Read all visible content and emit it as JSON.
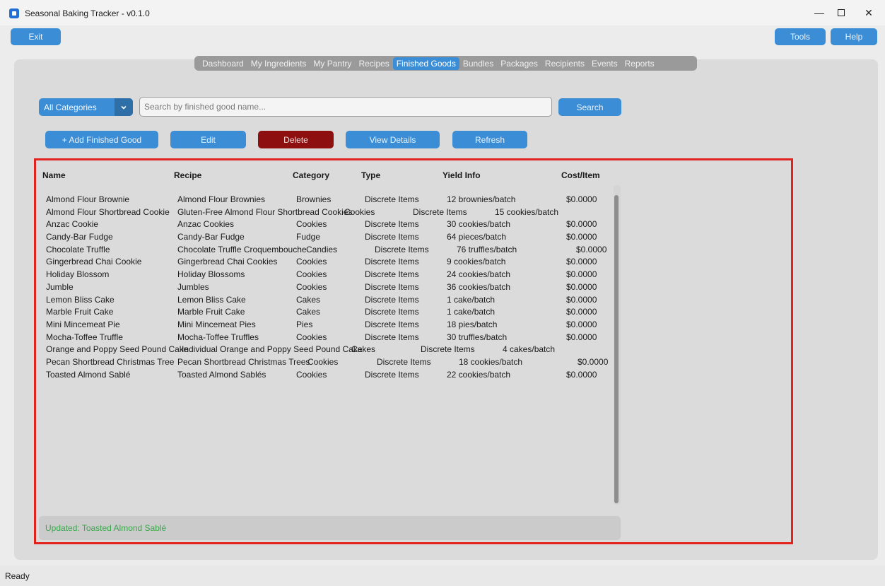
{
  "window": {
    "title": "Seasonal Baking Tracker - v0.1.0",
    "minimize_glyph": "—",
    "close_glyph": "✕"
  },
  "toolbar": {
    "exit_label": "Exit",
    "tools_label": "Tools",
    "help_label": "Help"
  },
  "tabs": [
    {
      "label": "Dashboard"
    },
    {
      "label": "My Ingredients"
    },
    {
      "label": "My Pantry"
    },
    {
      "label": "Recipes"
    },
    {
      "label": "Finished Goods",
      "active": true
    },
    {
      "label": "Bundles"
    },
    {
      "label": "Packages"
    },
    {
      "label": "Recipients"
    },
    {
      "label": "Events"
    },
    {
      "label": "Reports"
    }
  ],
  "filter": {
    "category_selected": "All Categories",
    "search_placeholder": "Search by finished good name...",
    "search_label": "Search"
  },
  "actions": {
    "add_label": "+ Add Finished Good",
    "edit_label": "Edit",
    "delete_label": "Delete",
    "view_label": "View Details",
    "refresh_label": "Refresh"
  },
  "table": {
    "headers": {
      "name": "Name",
      "recipe": "Recipe",
      "category": "Category",
      "type": "Type",
      "yield": "Yield Info",
      "cost": "Cost/Item"
    },
    "rows": [
      {
        "name": "Almond Flour Brownie",
        "recipe": "Almond Flour Brownies",
        "category": "Brownies",
        "type": "Discrete Items",
        "yield": "12 brownies/batch",
        "cost": "$0.0000"
      },
      {
        "name": "Almond Flour Shortbread Cookie",
        "recipe": "Gluten-Free Almond Flour Shortbread Cookies",
        "category": "Cookies",
        "type": "Discrete Items",
        "yield": "15 cookies/batch",
        "cost": ""
      },
      {
        "name": "Anzac Cookie",
        "recipe": "Anzac Cookies",
        "category": "Cookies",
        "type": "Discrete Items",
        "yield": "30 cookies/batch",
        "cost": "$0.0000"
      },
      {
        "name": "Candy-Bar Fudge",
        "recipe": "Candy-Bar Fudge",
        "category": "Fudge",
        "type": "Discrete Items",
        "yield": "64 pieces/batch",
        "cost": "$0.0000"
      },
      {
        "name": "Chocolate Truffle",
        "recipe": "Chocolate Truffle Croquembouche",
        "category": "Candies",
        "type": "Discrete Items",
        "yield": "76 truffles/batch",
        "cost": "$0.0000"
      },
      {
        "name": "Gingerbread Chai Cookie",
        "recipe": "Gingerbread Chai Cookies",
        "category": "Cookies",
        "type": "Discrete Items",
        "yield": "9 cookies/batch",
        "cost": "$0.0000"
      },
      {
        "name": "Holiday Blossom",
        "recipe": "Holiday Blossoms",
        "category": "Cookies",
        "type": "Discrete Items",
        "yield": "24 cookies/batch",
        "cost": "$0.0000"
      },
      {
        "name": "Jumble",
        "recipe": "Jumbles",
        "category": "Cookies",
        "type": "Discrete Items",
        "yield": "36 cookies/batch",
        "cost": "$0.0000"
      },
      {
        "name": "Lemon Bliss Cake",
        "recipe": "Lemon Bliss Cake",
        "category": "Cakes",
        "type": "Discrete Items",
        "yield": "1 cake/batch",
        "cost": "$0.0000"
      },
      {
        "name": "Marble Fruit Cake",
        "recipe": "Marble Fruit Cake",
        "category": "Cakes",
        "type": "Discrete Items",
        "yield": "1 cake/batch",
        "cost": "$0.0000"
      },
      {
        "name": "Mini Mincemeat Pie",
        "recipe": "Mini Mincemeat Pies",
        "category": "Pies",
        "type": "Discrete Items",
        "yield": "18 pies/batch",
        "cost": "$0.0000"
      },
      {
        "name": "Mocha-Toffee Truffle",
        "recipe": "Mocha-Toffee Truffles",
        "category": "Cookies",
        "type": "Discrete Items",
        "yield": "30 truffles/batch",
        "cost": "$0.0000"
      },
      {
        "name": "Orange and Poppy Seed Pound Cake",
        "recipe": "Individual Orange and Poppy Seed Pound Cake",
        "category": "Cakes",
        "type": "Discrete Items",
        "yield": "4 cakes/batch",
        "cost": ""
      },
      {
        "name": "Pecan Shortbread Christmas Tree",
        "recipe": "Pecan Shortbread Christmas Trees",
        "category": "Cookies",
        "type": "Discrete Items",
        "yield": "18 cookies/batch",
        "cost": "$0.0000"
      },
      {
        "name": "Toasted Almond Sablé",
        "recipe": "Toasted Almond Sablés",
        "category": "Cookies",
        "type": "Discrete Items",
        "yield": "22 cookies/batch",
        "cost": "$0.0000"
      }
    ]
  },
  "status_message": "Updated: Toasted Almond Sablé",
  "statusbar_text": "Ready",
  "colors": {
    "accent": "#3b8ed6",
    "delete": "#8e0f0f",
    "success_text": "#3aa84b",
    "highlight_border": "#e0231f"
  }
}
